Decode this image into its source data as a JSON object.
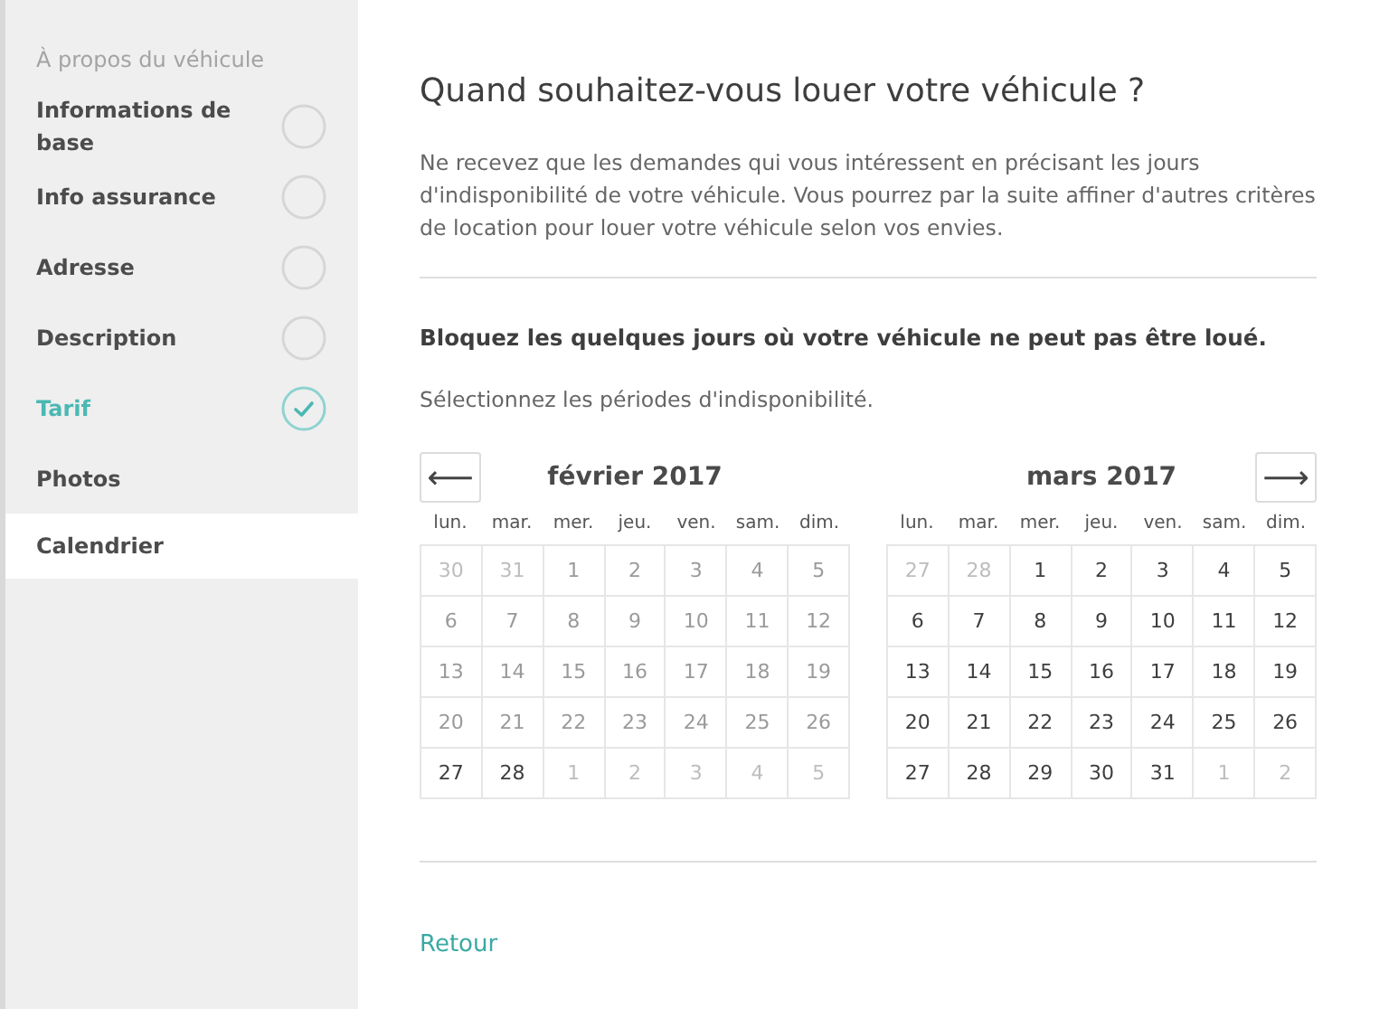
{
  "sidebar": {
    "heading": "À propos du véhicule",
    "items": [
      {
        "label": "Informations de base",
        "kind": "step",
        "done": false,
        "selected": false
      },
      {
        "label": "Info assurance",
        "kind": "step",
        "done": false,
        "selected": false
      },
      {
        "label": "Adresse",
        "kind": "step",
        "done": false,
        "selected": false
      },
      {
        "label": "Description",
        "kind": "step",
        "done": false,
        "selected": false
      },
      {
        "label": "Tarif",
        "kind": "step",
        "done": true,
        "selected": false
      },
      {
        "label": "Photos",
        "kind": "plain",
        "selected": false
      },
      {
        "label": "Calendrier",
        "kind": "plain",
        "selected": true
      }
    ]
  },
  "title": "Quand souhaitez-vous louer votre véhicule ?",
  "intro": "Ne recevez que les demandes qui vous intéressent en précisant les jours d'indisponibilité de votre véhicule. Vous pourrez par la suite affiner d'autres critères de location pour louer votre véhicule selon vos envies.",
  "block_heading": "Bloquez les quelques jours où votre véhicule ne peut pas être loué.",
  "block_hint": "Sélectionnez les périodes d'indisponibilité.",
  "nav": {
    "prev": "⟵",
    "next": "⟶"
  },
  "months": [
    {
      "title": "février 2017",
      "weekdays": [
        "lun.",
        "mar.",
        "mer.",
        "jeu.",
        "ven.",
        "sam.",
        "dim."
      ],
      "days": [
        {
          "label": "30",
          "kind": "outside"
        },
        {
          "label": "31",
          "kind": "outside"
        },
        {
          "label": "1",
          "kind": "past"
        },
        {
          "label": "2",
          "kind": "past"
        },
        {
          "label": "3",
          "kind": "past"
        },
        {
          "label": "4",
          "kind": "past"
        },
        {
          "label": "5",
          "kind": "past"
        },
        {
          "label": "6",
          "kind": "past"
        },
        {
          "label": "7",
          "kind": "past"
        },
        {
          "label": "8",
          "kind": "past"
        },
        {
          "label": "9",
          "kind": "past"
        },
        {
          "label": "10",
          "kind": "past"
        },
        {
          "label": "11",
          "kind": "past"
        },
        {
          "label": "12",
          "kind": "past"
        },
        {
          "label": "13",
          "kind": "past"
        },
        {
          "label": "14",
          "kind": "past"
        },
        {
          "label": "15",
          "kind": "past"
        },
        {
          "label": "16",
          "kind": "past"
        },
        {
          "label": "17",
          "kind": "past"
        },
        {
          "label": "18",
          "kind": "past"
        },
        {
          "label": "19",
          "kind": "past"
        },
        {
          "label": "20",
          "kind": "past"
        },
        {
          "label": "21",
          "kind": "past"
        },
        {
          "label": "22",
          "kind": "past"
        },
        {
          "label": "23",
          "kind": "past"
        },
        {
          "label": "24",
          "kind": "past"
        },
        {
          "label": "25",
          "kind": "past"
        },
        {
          "label": "26",
          "kind": "past"
        },
        {
          "label": "27",
          "kind": "open"
        },
        {
          "label": "28",
          "kind": "open"
        },
        {
          "label": "1",
          "kind": "outside"
        },
        {
          "label": "2",
          "kind": "outside"
        },
        {
          "label": "3",
          "kind": "outside"
        },
        {
          "label": "4",
          "kind": "outside"
        },
        {
          "label": "5",
          "kind": "outside"
        }
      ]
    },
    {
      "title": "mars 2017",
      "weekdays": [
        "lun.",
        "mar.",
        "mer.",
        "jeu.",
        "ven.",
        "sam.",
        "dim."
      ],
      "days": [
        {
          "label": "27",
          "kind": "outside"
        },
        {
          "label": "28",
          "kind": "outside"
        },
        {
          "label": "1",
          "kind": "open"
        },
        {
          "label": "2",
          "kind": "open"
        },
        {
          "label": "3",
          "kind": "open"
        },
        {
          "label": "4",
          "kind": "open"
        },
        {
          "label": "5",
          "kind": "open"
        },
        {
          "label": "6",
          "kind": "open"
        },
        {
          "label": "7",
          "kind": "open"
        },
        {
          "label": "8",
          "kind": "open"
        },
        {
          "label": "9",
          "kind": "open"
        },
        {
          "label": "10",
          "kind": "open"
        },
        {
          "label": "11",
          "kind": "open"
        },
        {
          "label": "12",
          "kind": "open"
        },
        {
          "label": "13",
          "kind": "open"
        },
        {
          "label": "14",
          "kind": "open"
        },
        {
          "label": "15",
          "kind": "open"
        },
        {
          "label": "16",
          "kind": "open"
        },
        {
          "label": "17",
          "kind": "open"
        },
        {
          "label": "18",
          "kind": "open"
        },
        {
          "label": "19",
          "kind": "open"
        },
        {
          "label": "20",
          "kind": "open"
        },
        {
          "label": "21",
          "kind": "open"
        },
        {
          "label": "22",
          "kind": "open"
        },
        {
          "label": "23",
          "kind": "open"
        },
        {
          "label": "24",
          "kind": "open"
        },
        {
          "label": "25",
          "kind": "open"
        },
        {
          "label": "26",
          "kind": "open"
        },
        {
          "label": "27",
          "kind": "open"
        },
        {
          "label": "28",
          "kind": "open"
        },
        {
          "label": "29",
          "kind": "open"
        },
        {
          "label": "30",
          "kind": "open"
        },
        {
          "label": "31",
          "kind": "open"
        },
        {
          "label": "1",
          "kind": "outside"
        },
        {
          "label": "2",
          "kind": "outside"
        }
      ]
    }
  ],
  "back_link": "Retour"
}
